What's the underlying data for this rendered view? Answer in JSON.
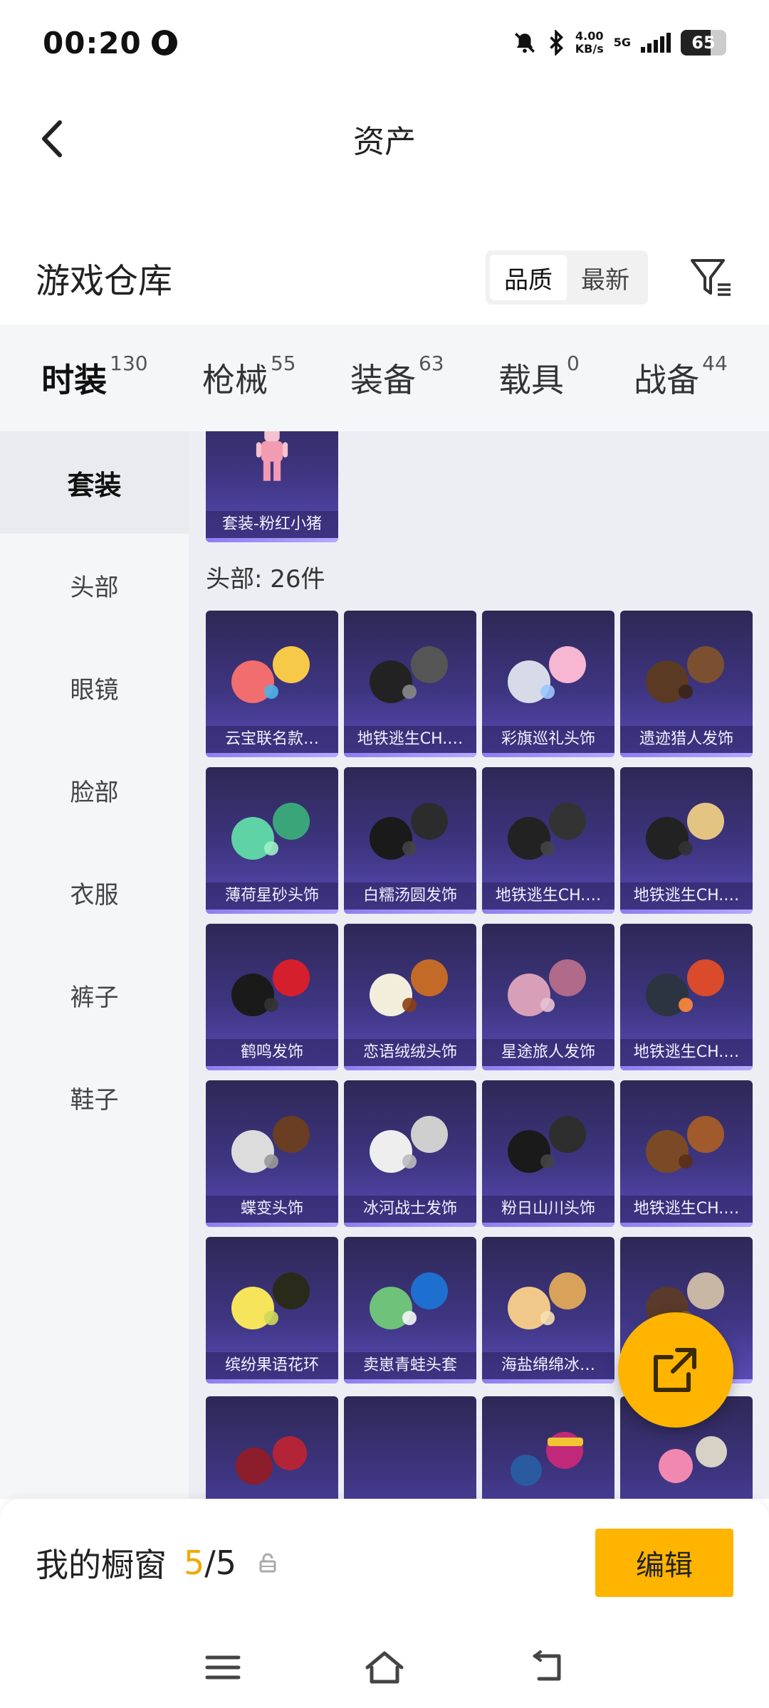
{
  "status_bar": {
    "time": "00:20",
    "speed_value": "4.00",
    "speed_unit": "KB/s",
    "network": "5G",
    "battery": "65",
    "battery_level": 0.65
  },
  "header": {
    "title": "资产"
  },
  "warehouse": {
    "title": "游戏仓库",
    "sort_options": [
      "品质",
      "最新"
    ],
    "sort_selected": "品质"
  },
  "tabs": [
    {
      "label": "时装",
      "count": "130"
    },
    {
      "label": "枪械",
      "count": "55"
    },
    {
      "label": "装备",
      "count": "63"
    },
    {
      "label": "载具",
      "count": "0"
    },
    {
      "label": "战备",
      "count": "44"
    }
  ],
  "sidebar": [
    "套装",
    "头部",
    "眼镜",
    "脸部",
    "衣服",
    "裤子",
    "鞋子"
  ],
  "suit_card": {
    "name": "套装-粉红小猪"
  },
  "head_section": {
    "label": "头部: 26件",
    "items": [
      "云宝联名款…",
      "地铁逃生CH.…",
      "彩旗巡礼头饰",
      "遗迹猎人发饰",
      "薄荷星砂头饰",
      "白糯汤圆发饰",
      "地铁逃生CH.…",
      "地铁逃生CH.…",
      "鹤鸣发饰",
      "恋语绒绒头饰",
      "星途旅人发饰",
      "地铁逃生CH.…",
      "蝶变头饰",
      "冰河战士发饰",
      "粉日山川头饰",
      "地铁逃生CH.…",
      "缤纷果语花环",
      "卖崽青蛙头套",
      "海盐绵绵冰…",
      ""
    ]
  },
  "showcase": {
    "label": "我的橱窗",
    "current": "5",
    "separator": "/",
    "total": "5",
    "edit_label": "编辑"
  },
  "colors": {
    "accent": "#ffb400",
    "card_top": "#2e2856",
    "card_bottom": "#5a4cb8"
  }
}
